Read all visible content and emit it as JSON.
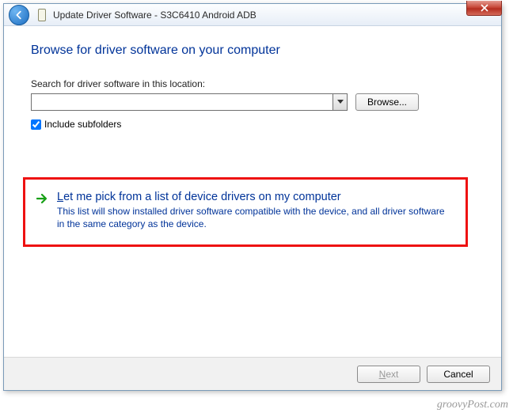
{
  "window": {
    "title": "Update Driver Software - S3C6410 Android ADB"
  },
  "content": {
    "heading": "Browse for driver software on your computer",
    "search_label": "Search for driver software in this location:",
    "path_value": "",
    "browse_label": "Browse...",
    "include_subfolders_label": "Include subfolders",
    "include_subfolders_checked": true
  },
  "option": {
    "title_prefix": "L",
    "title_rest": "et me pick from a list of device drivers on my computer",
    "description": "This list will show installed driver software compatible with the device, and all driver software in the same category as the device."
  },
  "footer": {
    "next_label": "Next",
    "cancel_label": "Cancel"
  },
  "watermark": "groovyPost.com"
}
